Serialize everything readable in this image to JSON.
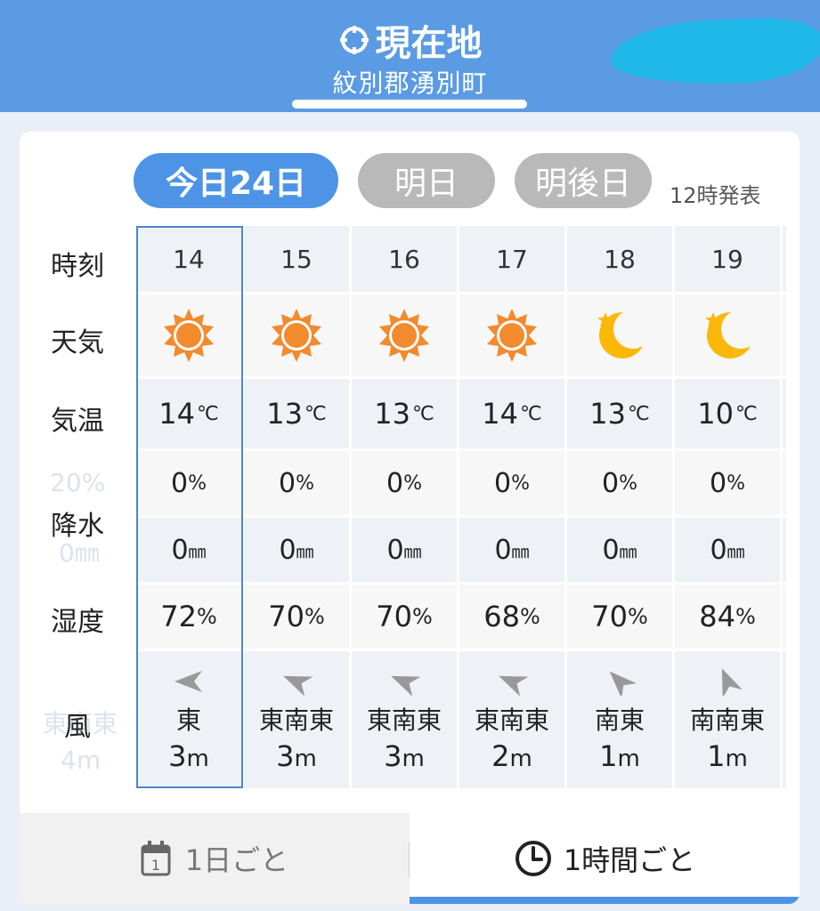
{
  "header": {
    "title": "現在地",
    "subtitle": "紋別郡湧別町"
  },
  "day_tabs": [
    {
      "label": "今日24日",
      "active": true
    },
    {
      "label": "明日",
      "active": false
    },
    {
      "label": "明後日",
      "active": false
    }
  ],
  "issued": "12時発表",
  "row_labels": {
    "time": "時刻",
    "weather": "天気",
    "temp": "気温",
    "precip": "降水",
    "humidity": "湿度",
    "wind": "風"
  },
  "ghost": {
    "pct": "20%",
    "rain": "0㎜",
    "dir": "東南東",
    "speed": "4m"
  },
  "hours": [
    {
      "time": "14",
      "weather_icon": "sun-icon",
      "temp": "14",
      "temp_unit": "℃",
      "pop": "0",
      "pop_unit": "%",
      "rain": "0",
      "rain_unit": "㎜",
      "humidity": "72",
      "hum_unit": "%",
      "wind_dir": "東",
      "wind_speed": "3",
      "speed_unit": "m",
      "wind_from_angle": 0
    },
    {
      "time": "15",
      "weather_icon": "sun-icon",
      "temp": "13",
      "temp_unit": "℃",
      "pop": "0",
      "pop_unit": "%",
      "rain": "0",
      "rain_unit": "㎜",
      "humidity": "70",
      "hum_unit": "%",
      "wind_dir": "東南東",
      "wind_speed": "3",
      "speed_unit": "m",
      "wind_from_angle": 22.5
    },
    {
      "time": "16",
      "weather_icon": "sun-icon",
      "temp": "13",
      "temp_unit": "℃",
      "pop": "0",
      "pop_unit": "%",
      "rain": "0",
      "rain_unit": "㎜",
      "humidity": "70",
      "hum_unit": "%",
      "wind_dir": "東南東",
      "wind_speed": "3",
      "speed_unit": "m",
      "wind_from_angle": 22.5
    },
    {
      "time": "17",
      "weather_icon": "sun-icon",
      "temp": "14",
      "temp_unit": "℃",
      "pop": "0",
      "pop_unit": "%",
      "rain": "0",
      "rain_unit": "㎜",
      "humidity": "68",
      "hum_unit": "%",
      "wind_dir": "東南東",
      "wind_speed": "2",
      "speed_unit": "m",
      "wind_from_angle": 22.5
    },
    {
      "time": "18",
      "weather_icon": "moon-icon",
      "temp": "13",
      "temp_unit": "℃",
      "pop": "0",
      "pop_unit": "%",
      "rain": "0",
      "rain_unit": "㎜",
      "humidity": "70",
      "hum_unit": "%",
      "wind_dir": "南東",
      "wind_speed": "1",
      "speed_unit": "m",
      "wind_from_angle": 45
    },
    {
      "time": "19",
      "weather_icon": "moon-icon",
      "temp": "10",
      "temp_unit": "℃",
      "pop": "0",
      "pop_unit": "%",
      "rain": "0",
      "rain_unit": "㎜",
      "humidity": "84",
      "hum_unit": "%",
      "wind_dir": "南南東",
      "wind_speed": "1",
      "speed_unit": "m",
      "wind_from_angle": 67.5
    }
  ],
  "bottom_nav": {
    "daily_label": "1日ごと",
    "daily_icon_number": "1",
    "hourly_label": "1時間ごと",
    "active": "hourly"
  },
  "colors": {
    "header_bg": "#5b9be3",
    "accent_blue": "#4d94e6",
    "sun_orange": "#f28a2e",
    "moon_yellow": "#fbb80a"
  }
}
